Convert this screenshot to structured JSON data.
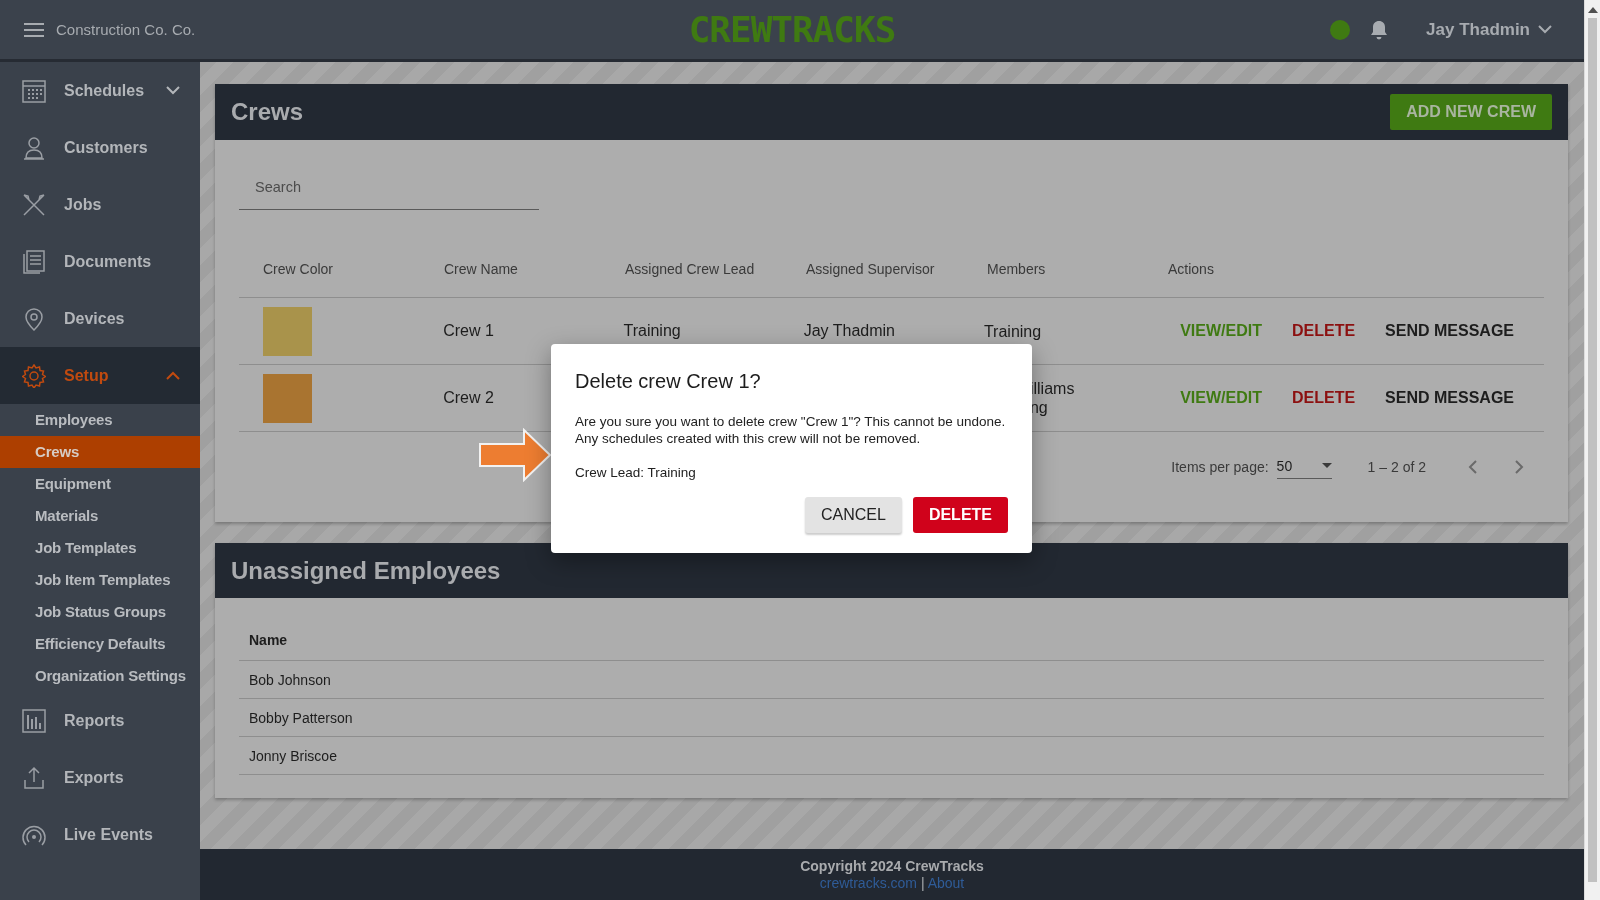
{
  "top_bar": {
    "company": "Construction Co. Co.",
    "logo": "CREWTRACKS",
    "user": "Jay Thadmin"
  },
  "sidebar": {
    "items": [
      {
        "label": "Schedules",
        "expanded": false,
        "selected": false
      },
      {
        "label": "Customers",
        "selected": false
      },
      {
        "label": "Jobs",
        "selected": false
      },
      {
        "label": "Documents",
        "selected": false
      },
      {
        "label": "Devices",
        "selected": false
      },
      {
        "label": "Setup",
        "expanded": true,
        "selected": true,
        "children": [
          {
            "label": "Employees",
            "selected": false
          },
          {
            "label": "Crews",
            "selected": true
          },
          {
            "label": "Equipment",
            "selected": false
          },
          {
            "label": "Materials",
            "selected": false
          },
          {
            "label": "Job Templates",
            "selected": false
          },
          {
            "label": "Job Item Templates",
            "selected": false
          },
          {
            "label": "Job Status Groups",
            "selected": false
          },
          {
            "label": "Efficiency Defaults",
            "selected": false
          },
          {
            "label": "Organization Settings",
            "selected": false
          }
        ]
      },
      {
        "label": "Reports",
        "selected": false
      },
      {
        "label": "Exports",
        "selected": false
      },
      {
        "label": "Live Events",
        "selected": false
      }
    ]
  },
  "crews": {
    "title": "Crews",
    "add_button": "ADD NEW CREW",
    "search": {
      "placeholder": "Search"
    },
    "columns": [
      "Crew Color",
      "Crew Name",
      "Assigned Crew Lead",
      "Assigned Supervisor",
      "Members",
      "Actions"
    ],
    "rows": [
      {
        "color": "#a9934b",
        "name": "Crew 1",
        "lead": "Training",
        "supervisor": "Jay Thadmin",
        "members": [
          "Training"
        ],
        "actions": [
          {
            "label": "VIEW/EDIT",
            "kind": "edit"
          },
          {
            "label": "DELETE",
            "kind": "delete"
          },
          {
            "label": "SEND MESSAGE",
            "kind": "message"
          }
        ]
      },
      {
        "color": "#a97430",
        "name": "Crew 2",
        "members": [
          "illiams",
          "ng"
        ],
        "members_cut": true,
        "actions": [
          {
            "label": "VIEW/EDIT",
            "kind": "edit"
          },
          {
            "label": "DELETE",
            "kind": "delete"
          },
          {
            "label": "SEND MESSAGE",
            "kind": "message"
          }
        ]
      }
    ],
    "pagination": {
      "items_per_page_label": "Items per page:",
      "items_per_page": "50",
      "range": "1 – 2 of 2"
    }
  },
  "unassigned": {
    "title": "Unassigned Employees",
    "column": "Name",
    "rows": [
      "Bob Johnson",
      "Bobby Patterson",
      "Jonny Briscoe"
    ]
  },
  "dialog": {
    "title": "Delete crew Crew 1?",
    "message": [
      "Are you sure you want to delete crew \"Crew 1\"? This cannot be undone.",
      "Any schedules created with this crew will not be removed."
    ],
    "detail": "Crew Lead: Training",
    "buttons": [
      {
        "label": "CANCEL",
        "kind": "cancel"
      },
      {
        "label": "DELETE",
        "kind": "confirm"
      }
    ]
  },
  "footer": {
    "copyright": "Copyright 2024 CrewTracks",
    "links": [
      "crewtracks.com",
      "About"
    ],
    "separator": "|"
  }
}
